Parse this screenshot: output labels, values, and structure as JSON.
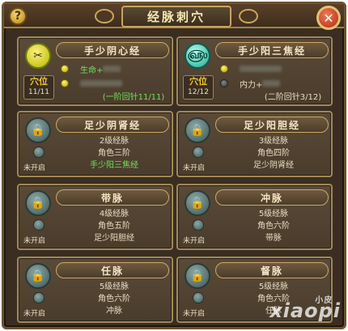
{
  "header": {
    "title": "经脉刺穴",
    "help_label": "?",
    "close_label": "✕"
  },
  "cards": [
    {
      "name": "手少阴心经",
      "active": true,
      "orb": "gold",
      "level_label": "穴位",
      "level": "11/11",
      "stats": [
        {
          "text": "生命+",
          "icon": "gold"
        },
        {
          "text": "",
          "icon": "gold"
        }
      ],
      "footer": "(一阶回针11/11)"
    },
    {
      "name": "手少阳三焦经",
      "active": true,
      "orb": "teal",
      "level_label": "穴位",
      "level": "12/12",
      "stats": [
        {
          "text": "",
          "icon": "gold"
        },
        {
          "text": "内力+",
          "icon": "dark"
        }
      ],
      "footer": "(二阶回针3/12)"
    },
    {
      "name": "足少阴肾经",
      "status": "未开启",
      "lines": [
        "2级经脉",
        "角色三阶",
        "手少阳三焦经"
      ],
      "highlight_last": true
    },
    {
      "name": "足少阳胆经",
      "status": "未开启",
      "lines": [
        "3级经脉",
        "角色四阶",
        "足少阴肾经"
      ],
      "highlight_last": false
    },
    {
      "name": "带脉",
      "status": "未开启",
      "lines": [
        "4级经脉",
        "角色五阶",
        "足少阳胆经"
      ],
      "highlight_last": false
    },
    {
      "name": "冲脉",
      "status": "未开启",
      "lines": [
        "5级经脉",
        "角色六阶",
        "带脉"
      ],
      "highlight_last": false
    },
    {
      "name": "任脉",
      "status": "未开启",
      "lines": [
        "5级经脉",
        "角色六阶",
        "冲脉"
      ],
      "highlight_last": false
    },
    {
      "name": "督脉",
      "status": "未开启",
      "lines": [
        "5级经脉",
        "角色六阶",
        "任脉"
      ],
      "highlight_last": false
    }
  ],
  "watermark": {
    "text": "xiaopi",
    "sub": "小皮"
  }
}
